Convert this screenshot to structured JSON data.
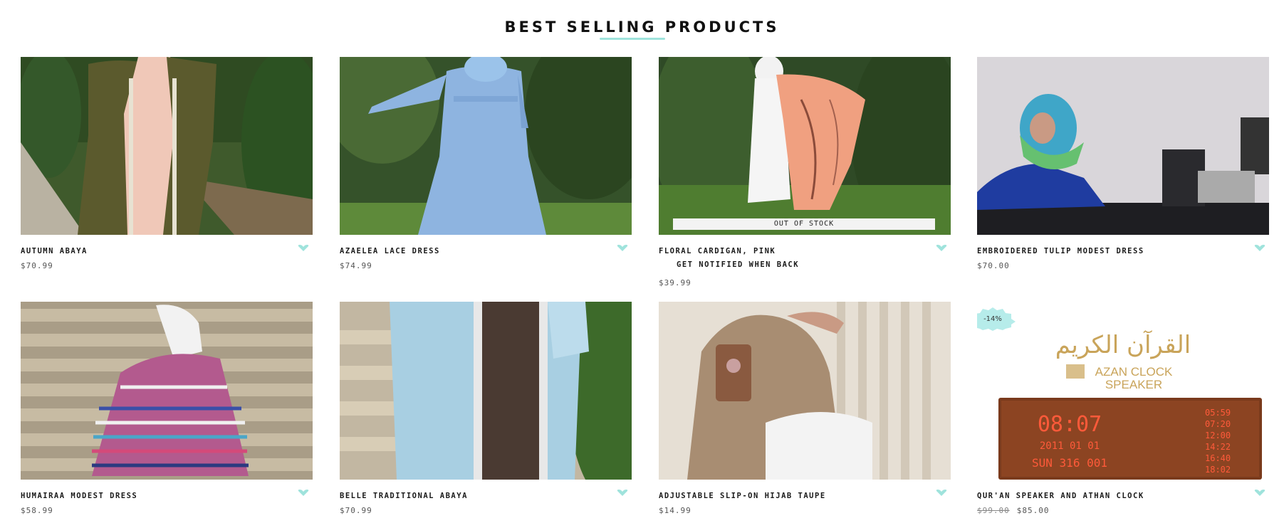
{
  "section": {
    "title": "BEST SELLING PRODUCTS"
  },
  "colors": {
    "accent": "#9fe3dc",
    "text": "#1a1a1a",
    "price": "#555555"
  },
  "products": [
    {
      "name": "AUTUMN ABAYA",
      "price": "$70.99",
      "image": "woman-olive-abaya-photo"
    },
    {
      "name": "AZAELEA LACE DRESS",
      "price": "$74.99",
      "image": "woman-blue-lace-dress-photo"
    },
    {
      "name": "FLORAL CARDIGAN, PINK",
      "price": "$39.99",
      "badge": "OUT OF STOCK",
      "notify": "GET NOTIFIED WHEN BACK",
      "image": "woman-pink-floral-cardigan-photo"
    },
    {
      "name": "EMBROIDERED TULIP MODEST DRESS",
      "price": "$70.00",
      "image": "woman-tulip-dress-desk-photo"
    },
    {
      "name": "HUMAIRAA MODEST DRESS",
      "price": "$58.99",
      "image": "woman-striped-dress-stairs-photo"
    },
    {
      "name": "BELLE TRADITIONAL ABAYA",
      "price": "$70.99",
      "image": "woman-light-blue-abaya-photo"
    },
    {
      "name": "ADJUSTABLE SLIP-ON HIJAB TAUPE",
      "price": "$14.99",
      "image": "woman-taupe-hijab-mirror-selfie"
    },
    {
      "name": "QUR'AN SPEAKER AND ATHAN CLOCK",
      "old_price": "$99.00",
      "price": "$85.00",
      "sale": "-14%",
      "image": "azan-clock-speaker-product"
    }
  ],
  "clock_product": {
    "arabic_title": "القرآن الكريم",
    "brand_line1": "AZAN CLOCK",
    "brand_line2": "SPEAKER",
    "time": "08:07",
    "date": "2011 01 01",
    "day": "SUN 316 001",
    "prayer_times": [
      "05:59",
      "07:20",
      "12:00",
      "14:22",
      "16:40",
      "18:02"
    ]
  }
}
